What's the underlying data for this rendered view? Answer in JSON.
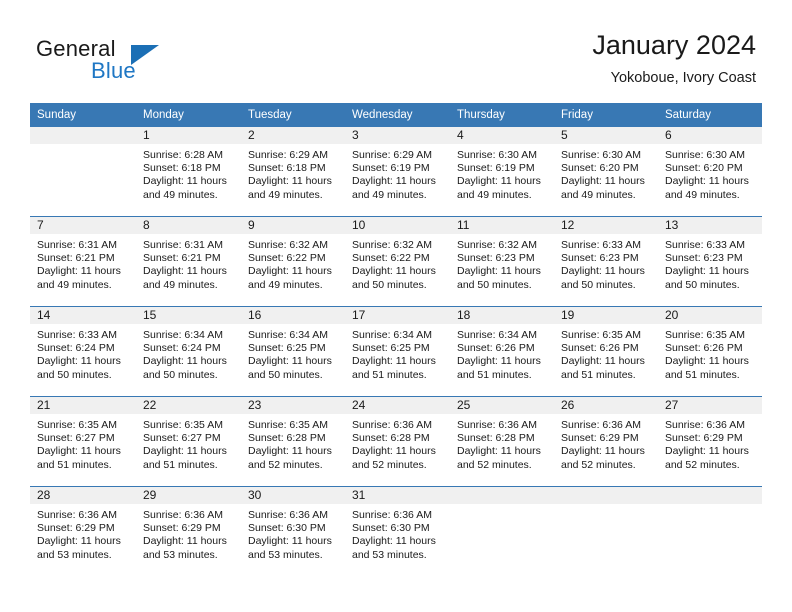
{
  "brand": {
    "name_primary": "General",
    "name_secondary": "Blue",
    "primary_color": "#1a1a1a",
    "secondary_color": "#1f77c4",
    "triangle_color": "#1b6fb5"
  },
  "header": {
    "title": "January 2024",
    "subtitle": "Yokoboue, Ivory Coast",
    "header_bg": "#3878b4",
    "daynum_bg": "#f0f0f0"
  },
  "weekdays": [
    "Sunday",
    "Monday",
    "Tuesday",
    "Wednesday",
    "Thursday",
    "Friday",
    "Saturday"
  ],
  "weeks": [
    [
      {
        "day": "",
        "sunrise": "",
        "sunset": "",
        "daylight1": "",
        "daylight2": ""
      },
      {
        "day": "1",
        "sunrise": "Sunrise: 6:28 AM",
        "sunset": "Sunset: 6:18 PM",
        "daylight1": "Daylight: 11 hours",
        "daylight2": "and 49 minutes."
      },
      {
        "day": "2",
        "sunrise": "Sunrise: 6:29 AM",
        "sunset": "Sunset: 6:18 PM",
        "daylight1": "Daylight: 11 hours",
        "daylight2": "and 49 minutes."
      },
      {
        "day": "3",
        "sunrise": "Sunrise: 6:29 AM",
        "sunset": "Sunset: 6:19 PM",
        "daylight1": "Daylight: 11 hours",
        "daylight2": "and 49 minutes."
      },
      {
        "day": "4",
        "sunrise": "Sunrise: 6:30 AM",
        "sunset": "Sunset: 6:19 PM",
        "daylight1": "Daylight: 11 hours",
        "daylight2": "and 49 minutes."
      },
      {
        "day": "5",
        "sunrise": "Sunrise: 6:30 AM",
        "sunset": "Sunset: 6:20 PM",
        "daylight1": "Daylight: 11 hours",
        "daylight2": "and 49 minutes."
      },
      {
        "day": "6",
        "sunrise": "Sunrise: 6:30 AM",
        "sunset": "Sunset: 6:20 PM",
        "daylight1": "Daylight: 11 hours",
        "daylight2": "and 49 minutes."
      }
    ],
    [
      {
        "day": "7",
        "sunrise": "Sunrise: 6:31 AM",
        "sunset": "Sunset: 6:21 PM",
        "daylight1": "Daylight: 11 hours",
        "daylight2": "and 49 minutes."
      },
      {
        "day": "8",
        "sunrise": "Sunrise: 6:31 AM",
        "sunset": "Sunset: 6:21 PM",
        "daylight1": "Daylight: 11 hours",
        "daylight2": "and 49 minutes."
      },
      {
        "day": "9",
        "sunrise": "Sunrise: 6:32 AM",
        "sunset": "Sunset: 6:22 PM",
        "daylight1": "Daylight: 11 hours",
        "daylight2": "and 49 minutes."
      },
      {
        "day": "10",
        "sunrise": "Sunrise: 6:32 AM",
        "sunset": "Sunset: 6:22 PM",
        "daylight1": "Daylight: 11 hours",
        "daylight2": "and 50 minutes."
      },
      {
        "day": "11",
        "sunrise": "Sunrise: 6:32 AM",
        "sunset": "Sunset: 6:23 PM",
        "daylight1": "Daylight: 11 hours",
        "daylight2": "and 50 minutes."
      },
      {
        "day": "12",
        "sunrise": "Sunrise: 6:33 AM",
        "sunset": "Sunset: 6:23 PM",
        "daylight1": "Daylight: 11 hours",
        "daylight2": "and 50 minutes."
      },
      {
        "day": "13",
        "sunrise": "Sunrise: 6:33 AM",
        "sunset": "Sunset: 6:23 PM",
        "daylight1": "Daylight: 11 hours",
        "daylight2": "and 50 minutes."
      }
    ],
    [
      {
        "day": "14",
        "sunrise": "Sunrise: 6:33 AM",
        "sunset": "Sunset: 6:24 PM",
        "daylight1": "Daylight: 11 hours",
        "daylight2": "and 50 minutes."
      },
      {
        "day": "15",
        "sunrise": "Sunrise: 6:34 AM",
        "sunset": "Sunset: 6:24 PM",
        "daylight1": "Daylight: 11 hours",
        "daylight2": "and 50 minutes."
      },
      {
        "day": "16",
        "sunrise": "Sunrise: 6:34 AM",
        "sunset": "Sunset: 6:25 PM",
        "daylight1": "Daylight: 11 hours",
        "daylight2": "and 50 minutes."
      },
      {
        "day": "17",
        "sunrise": "Sunrise: 6:34 AM",
        "sunset": "Sunset: 6:25 PM",
        "daylight1": "Daylight: 11 hours",
        "daylight2": "and 51 minutes."
      },
      {
        "day": "18",
        "sunrise": "Sunrise: 6:34 AM",
        "sunset": "Sunset: 6:26 PM",
        "daylight1": "Daylight: 11 hours",
        "daylight2": "and 51 minutes."
      },
      {
        "day": "19",
        "sunrise": "Sunrise: 6:35 AM",
        "sunset": "Sunset: 6:26 PM",
        "daylight1": "Daylight: 11 hours",
        "daylight2": "and 51 minutes."
      },
      {
        "day": "20",
        "sunrise": "Sunrise: 6:35 AM",
        "sunset": "Sunset: 6:26 PM",
        "daylight1": "Daylight: 11 hours",
        "daylight2": "and 51 minutes."
      }
    ],
    [
      {
        "day": "21",
        "sunrise": "Sunrise: 6:35 AM",
        "sunset": "Sunset: 6:27 PM",
        "daylight1": "Daylight: 11 hours",
        "daylight2": "and 51 minutes."
      },
      {
        "day": "22",
        "sunrise": "Sunrise: 6:35 AM",
        "sunset": "Sunset: 6:27 PM",
        "daylight1": "Daylight: 11 hours",
        "daylight2": "and 51 minutes."
      },
      {
        "day": "23",
        "sunrise": "Sunrise: 6:35 AM",
        "sunset": "Sunset: 6:28 PM",
        "daylight1": "Daylight: 11 hours",
        "daylight2": "and 52 minutes."
      },
      {
        "day": "24",
        "sunrise": "Sunrise: 6:36 AM",
        "sunset": "Sunset: 6:28 PM",
        "daylight1": "Daylight: 11 hours",
        "daylight2": "and 52 minutes."
      },
      {
        "day": "25",
        "sunrise": "Sunrise: 6:36 AM",
        "sunset": "Sunset: 6:28 PM",
        "daylight1": "Daylight: 11 hours",
        "daylight2": "and 52 minutes."
      },
      {
        "day": "26",
        "sunrise": "Sunrise: 6:36 AM",
        "sunset": "Sunset: 6:29 PM",
        "daylight1": "Daylight: 11 hours",
        "daylight2": "and 52 minutes."
      },
      {
        "day": "27",
        "sunrise": "Sunrise: 6:36 AM",
        "sunset": "Sunset: 6:29 PM",
        "daylight1": "Daylight: 11 hours",
        "daylight2": "and 52 minutes."
      }
    ],
    [
      {
        "day": "28",
        "sunrise": "Sunrise: 6:36 AM",
        "sunset": "Sunset: 6:29 PM",
        "daylight1": "Daylight: 11 hours",
        "daylight2": "and 53 minutes."
      },
      {
        "day": "29",
        "sunrise": "Sunrise: 6:36 AM",
        "sunset": "Sunset: 6:29 PM",
        "daylight1": "Daylight: 11 hours",
        "daylight2": "and 53 minutes."
      },
      {
        "day": "30",
        "sunrise": "Sunrise: 6:36 AM",
        "sunset": "Sunset: 6:30 PM",
        "daylight1": "Daylight: 11 hours",
        "daylight2": "and 53 minutes."
      },
      {
        "day": "31",
        "sunrise": "Sunrise: 6:36 AM",
        "sunset": "Sunset: 6:30 PM",
        "daylight1": "Daylight: 11 hours",
        "daylight2": "and 53 minutes."
      },
      {
        "day": "",
        "sunrise": "",
        "sunset": "",
        "daylight1": "",
        "daylight2": ""
      },
      {
        "day": "",
        "sunrise": "",
        "sunset": "",
        "daylight1": "",
        "daylight2": ""
      },
      {
        "day": "",
        "sunrise": "",
        "sunset": "",
        "daylight1": "",
        "daylight2": ""
      }
    ]
  ]
}
